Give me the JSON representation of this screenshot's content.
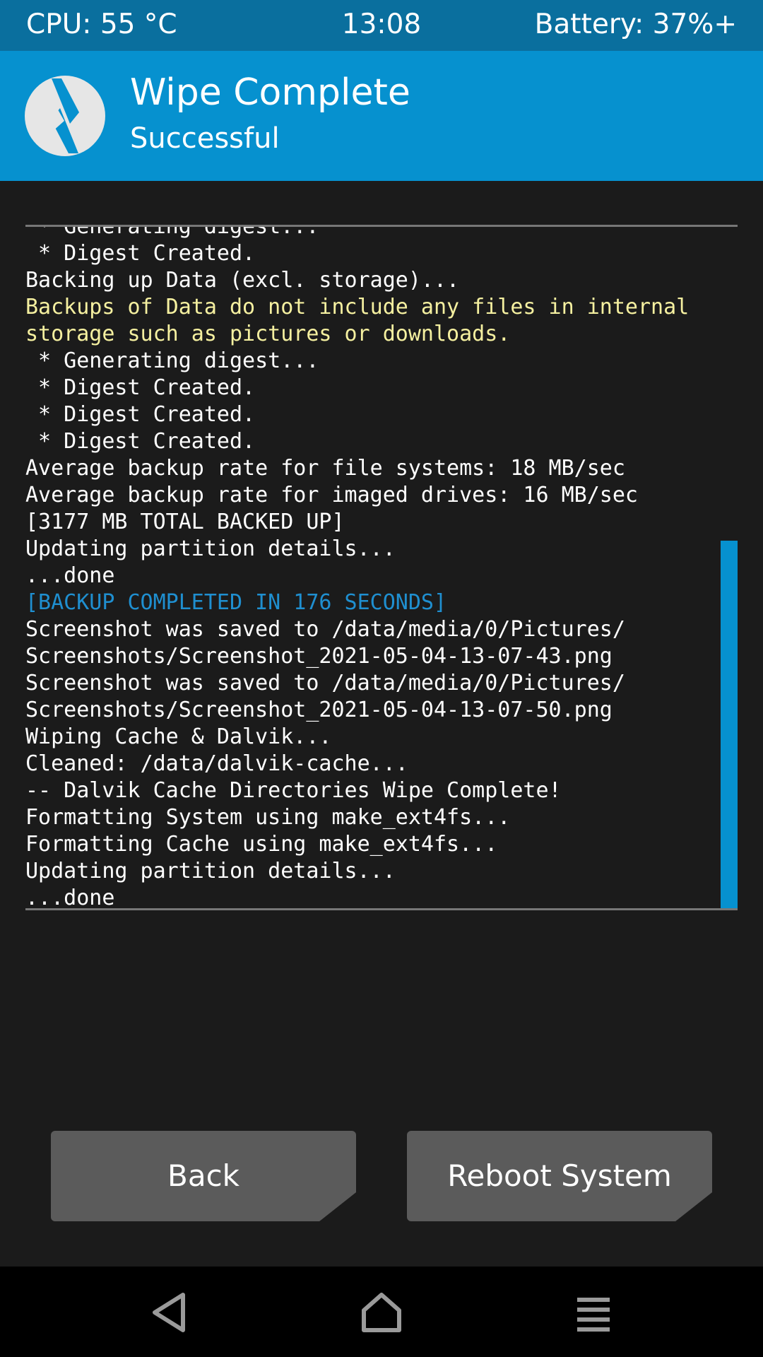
{
  "status_bar": {
    "cpu": "CPU: 55 °C",
    "time": "13:08",
    "battery": "Battery: 37%+"
  },
  "header": {
    "title": "Wipe Complete",
    "subtitle": "Successful",
    "logo_icon": "twrp-logo-icon"
  },
  "console": {
    "lines": [
      {
        "text": " * Generating digest...",
        "style": "normal"
      },
      {
        "text": " * Digest Created.",
        "style": "normal"
      },
      {
        "text": "Backing up Data (excl. storage)...",
        "style": "normal"
      },
      {
        "text": "Backups of Data do not include any files in internal",
        "style": "warning"
      },
      {
        "text": "storage such as pictures or downloads.",
        "style": "warning"
      },
      {
        "text": " * Generating digest...",
        "style": "normal"
      },
      {
        "text": " * Digest Created.",
        "style": "normal"
      },
      {
        "text": " * Digest Created.",
        "style": "normal"
      },
      {
        "text": " * Digest Created.",
        "style": "normal"
      },
      {
        "text": "Average backup rate for file systems: 18 MB/sec",
        "style": "normal"
      },
      {
        "text": "Average backup rate for imaged drives: 16 MB/sec",
        "style": "normal"
      },
      {
        "text": "[3177 MB TOTAL BACKED UP]",
        "style": "normal"
      },
      {
        "text": "Updating partition details...",
        "style": "normal"
      },
      {
        "text": "...done",
        "style": "normal"
      },
      {
        "text": "[BACKUP COMPLETED IN 176 SECONDS]",
        "style": "highlight"
      },
      {
        "text": "Screenshot was saved to /data/media/0/Pictures/",
        "style": "normal"
      },
      {
        "text": "Screenshots/Screenshot_2021-05-04-13-07-43.png",
        "style": "normal"
      },
      {
        "text": "Screenshot was saved to /data/media/0/Pictures/",
        "style": "normal"
      },
      {
        "text": "Screenshots/Screenshot_2021-05-04-13-07-50.png",
        "style": "normal"
      },
      {
        "text": "Wiping Cache & Dalvik...",
        "style": "normal"
      },
      {
        "text": "Cleaned: /data/dalvik-cache...",
        "style": "normal"
      },
      {
        "text": "-- Dalvik Cache Directories Wipe Complete!",
        "style": "normal"
      },
      {
        "text": "Formatting System using make_ext4fs...",
        "style": "normal"
      },
      {
        "text": "Formatting Cache using make_ext4fs...",
        "style": "normal"
      },
      {
        "text": "Updating partition details...",
        "style": "normal"
      },
      {
        "text": "...done",
        "style": "normal"
      }
    ],
    "colors": {
      "normal": "#ffffff",
      "warning": "#f5f0a0",
      "highlight": "#1f8fd0"
    }
  },
  "buttons": {
    "back_label": "Back",
    "reboot_label": "Reboot System"
  },
  "nav_bar": {
    "back_icon": "nav-back-icon",
    "home_icon": "nav-home-icon",
    "menu_icon": "nav-menu-icon"
  },
  "colors": {
    "status_bar": "#0a6f9e",
    "header": "#0691cf",
    "background": "#1b1b1b",
    "button": "#5b5b5b",
    "scrollbar": "#0691cf"
  }
}
